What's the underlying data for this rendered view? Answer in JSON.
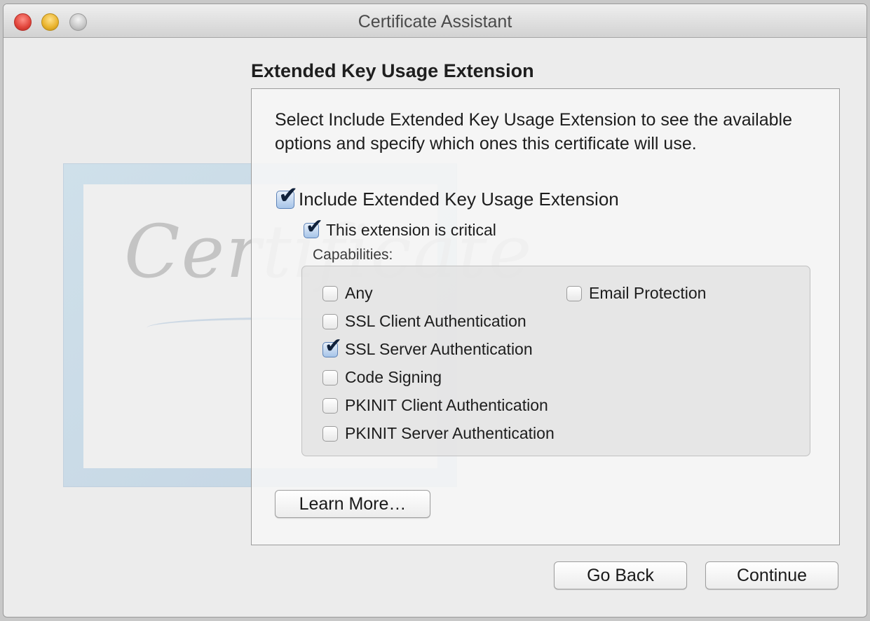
{
  "window": {
    "title": "Certificate Assistant"
  },
  "watermark": {
    "text": "Certificate"
  },
  "section": {
    "heading": "Extended Key Usage Extension"
  },
  "content": {
    "description": "Select Include Extended Key Usage Extension to see the available options and specify which ones this certificate will use.",
    "include_extension": {
      "label": "Include Extended Key Usage Extension",
      "checked": true
    },
    "critical": {
      "label": "This extension is critical",
      "checked": true
    },
    "capabilities_label": "Capabilities:",
    "capabilities": [
      {
        "label": "Any",
        "checked": false
      },
      {
        "label": "SSL Client Authentication",
        "checked": false
      },
      {
        "label": "SSL Server Authentication",
        "checked": true
      },
      {
        "label": "Code Signing",
        "checked": false
      },
      {
        "label": "PKINIT Client Authentication",
        "checked": false
      },
      {
        "label": "PKINIT Server Authentication",
        "checked": false
      },
      {
        "label": "Email Protection",
        "checked": false
      }
    ],
    "learn_more_label": "Learn More…"
  },
  "footer": {
    "back_label": "Go Back",
    "continue_label": "Continue"
  },
  "icons": {
    "checkmark": "✔"
  }
}
